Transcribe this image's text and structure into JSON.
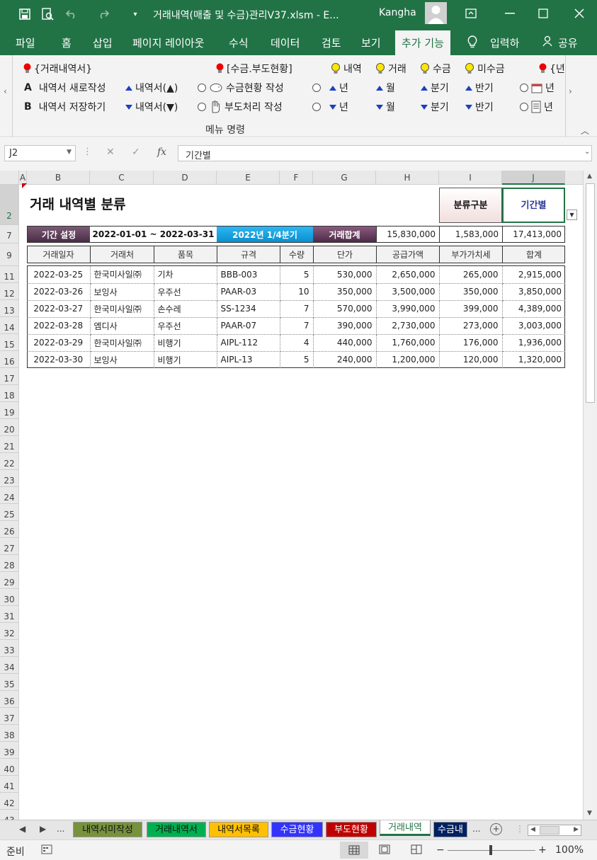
{
  "titlebar": {
    "title": "거래내역(매출 및 수금)관리V37.xlsm  -  E...",
    "user": "Kangha",
    "colors": {
      "bar": "#217346"
    }
  },
  "tabs": [
    "파일",
    "홈",
    "삽입",
    "페이지 레이아웃",
    "수식",
    "데이터",
    "검토",
    "보기",
    "추가 기능",
    "입력하",
    "공유"
  ],
  "ribbon": {
    "row1": {
      "trade_list": "{거래내역서}",
      "receipt_status": "[수금.부도현황]",
      "history": "내역",
      "trade": "거래",
      "receipt": "수금",
      "unpaid": "미수금",
      "year_cut": "{년"
    },
    "row2": {
      "key_a": "A",
      "new_statement": "내역서 새로작성",
      "statement_up": "내역서(▲)",
      "receipt_create": "수금현황 작성",
      "year": "년",
      "month": "월",
      "quarter": "분기",
      "half": "반기",
      "year_r": "년"
    },
    "row3": {
      "key_b": "B",
      "save_statement": "내역서 저장하기",
      "statement_down": "내역서(▼)",
      "bounce_create": "부도처리 작성",
      "year": "년",
      "month": "월",
      "quarter": "분기",
      "half": "반기",
      "year_r": "년"
    },
    "group_label": "메뉴 명령"
  },
  "formula": {
    "name_box": "J2",
    "fx": "fx",
    "content": "기간별"
  },
  "columns": [
    "A",
    "B",
    "C",
    "D",
    "E",
    "F",
    "G",
    "H",
    "I",
    "J"
  ],
  "rows": [
    "2",
    "7",
    "9",
    "11",
    "12",
    "13",
    "14",
    "15",
    "16",
    "17",
    "18",
    "19",
    "20",
    "21",
    "22",
    "23",
    "24",
    "25",
    "26",
    "27",
    "28",
    "29",
    "30",
    "31",
    "32",
    "33",
    "34",
    "35",
    "36",
    "37",
    "38",
    "39",
    "40",
    "41",
    "42",
    "43"
  ],
  "sheet": {
    "title": "거래 내역별 분류",
    "category_btn": "분류구분",
    "period_btn": "기간별",
    "period_label": "기간 설정",
    "period_value": "2022-01-01 ~ 2022-03-31",
    "quarter_label": "2022년 1/4분기",
    "total_label": "거래합계",
    "total_supply": "15,830,000",
    "total_vat": "1,583,000",
    "total_sum": "17,413,000",
    "headers": [
      "거래일자",
      "거래처",
      "품목",
      "규격",
      "수량",
      "단가",
      "공급가액",
      "부가가치세",
      "합계"
    ],
    "rows": [
      [
        "2022-03-25",
        "한국미사일㈜",
        "기차",
        "BBB-003",
        "5",
        "530,000",
        "2,650,000",
        "265,000",
        "2,915,000"
      ],
      [
        "2022-03-26",
        "보잉사",
        "우주선",
        "PAAR-03",
        "10",
        "350,000",
        "3,500,000",
        "350,000",
        "3,850,000"
      ],
      [
        "2022-03-27",
        "한국미사일㈜",
        "손수레",
        "SS-1234",
        "7",
        "570,000",
        "3,990,000",
        "399,000",
        "4,389,000"
      ],
      [
        "2022-03-28",
        "엠디사",
        "우주선",
        "PAAR-07",
        "7",
        "390,000",
        "2,730,000",
        "273,000",
        "3,003,000"
      ],
      [
        "2022-03-29",
        "한국미사일㈜",
        "비행기",
        "AIPL-112",
        "4",
        "440,000",
        "1,760,000",
        "176,000",
        "1,936,000"
      ],
      [
        "2022-03-30",
        "보잉사",
        "비행기",
        "AIPL-13",
        "5",
        "240,000",
        "1,200,000",
        "120,000",
        "1,320,000"
      ]
    ],
    "colors": {
      "period_label_bg": "#5e3c58",
      "quarter_bg": "#1ba1e2",
      "total_label_bg": "#6b3d5e",
      "header_bg": "#f2f2f2"
    }
  },
  "sheet_tabs": [
    {
      "label": "내역서미작성",
      "bg": "#76923c",
      "fg": "#111"
    },
    {
      "label": "거래내역서",
      "bg": "#00b050",
      "fg": "#111"
    },
    {
      "label": "내역서목록",
      "bg": "#ffc000",
      "fg": "#111"
    },
    {
      "label": "수금현황",
      "bg": "#3333ff",
      "fg": "#fff"
    },
    {
      "label": "부도현황",
      "bg": "#c00000",
      "fg": "#fff"
    },
    {
      "label": "거래내역",
      "bg": "#ffffff",
      "fg": "#217346"
    },
    {
      "label": "수금내",
      "bg": "#002060",
      "fg": "#fff"
    }
  ],
  "sheet_nav": {
    "prev": "◀",
    "next": "▶",
    "more": "...",
    "more2": "...",
    "add": "+"
  },
  "status": {
    "ready": "준비",
    "zoom": "100%",
    "minus": "−",
    "plus": "+"
  }
}
